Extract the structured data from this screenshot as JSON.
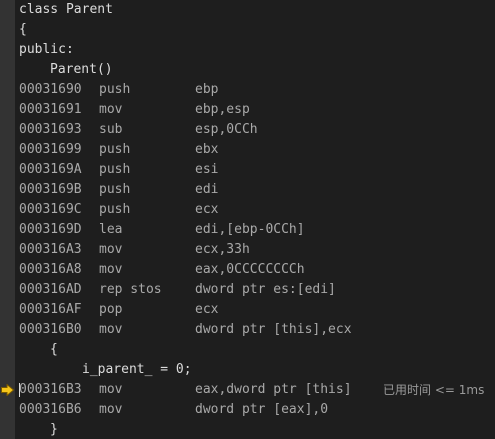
{
  "source_header": {
    "class_line": "class Parent",
    "open_brace": "{",
    "access": "public:",
    "ctor": "Parent()"
  },
  "asm": [
    {
      "addr": "00031690",
      "op": "push",
      "arg": "ebp"
    },
    {
      "addr": "00031691",
      "op": "mov",
      "arg": "ebp,esp"
    },
    {
      "addr": "00031693",
      "op": "sub",
      "arg": "esp,0CCh"
    },
    {
      "addr": "00031699",
      "op": "push",
      "arg": "ebx"
    },
    {
      "addr": "0003169A",
      "op": "push",
      "arg": "esi"
    },
    {
      "addr": "0003169B",
      "op": "push",
      "arg": "edi"
    },
    {
      "addr": "0003169C",
      "op": "push",
      "arg": "ecx"
    },
    {
      "addr": "0003169D",
      "op": "lea",
      "arg": "edi,[ebp-0CCh]"
    },
    {
      "addr": "000316A3",
      "op": "mov",
      "arg": "ecx,33h"
    },
    {
      "addr": "000316A8",
      "op": "mov",
      "arg": "eax,0CCCCCCCCh"
    },
    {
      "addr": "000316AD",
      "op": "rep stos",
      "arg": "dword ptr es:[edi]"
    },
    {
      "addr": "000316AF",
      "op": "pop",
      "arg": "ecx"
    },
    {
      "addr": "000316B0",
      "op": "mov",
      "arg": "dword ptr [this],ecx"
    }
  ],
  "body": {
    "open_brace": "{",
    "statement": "i_parent_ = 0;",
    "close_brace": "}"
  },
  "asm_after": [
    {
      "addr": "000316B3",
      "op": "mov",
      "arg": "eax,dword ptr [this]"
    },
    {
      "addr": "000316B6",
      "op": "mov",
      "arg": "dword ptr [eax],0"
    }
  ],
  "elapsed_hint": "已用时间 <= 1ms",
  "colors": {
    "background": "#1e1e1e",
    "gutter": "#333333",
    "arrow": "#f6c61a"
  },
  "icons": {
    "current_line": "instruction-pointer-arrow-icon"
  }
}
